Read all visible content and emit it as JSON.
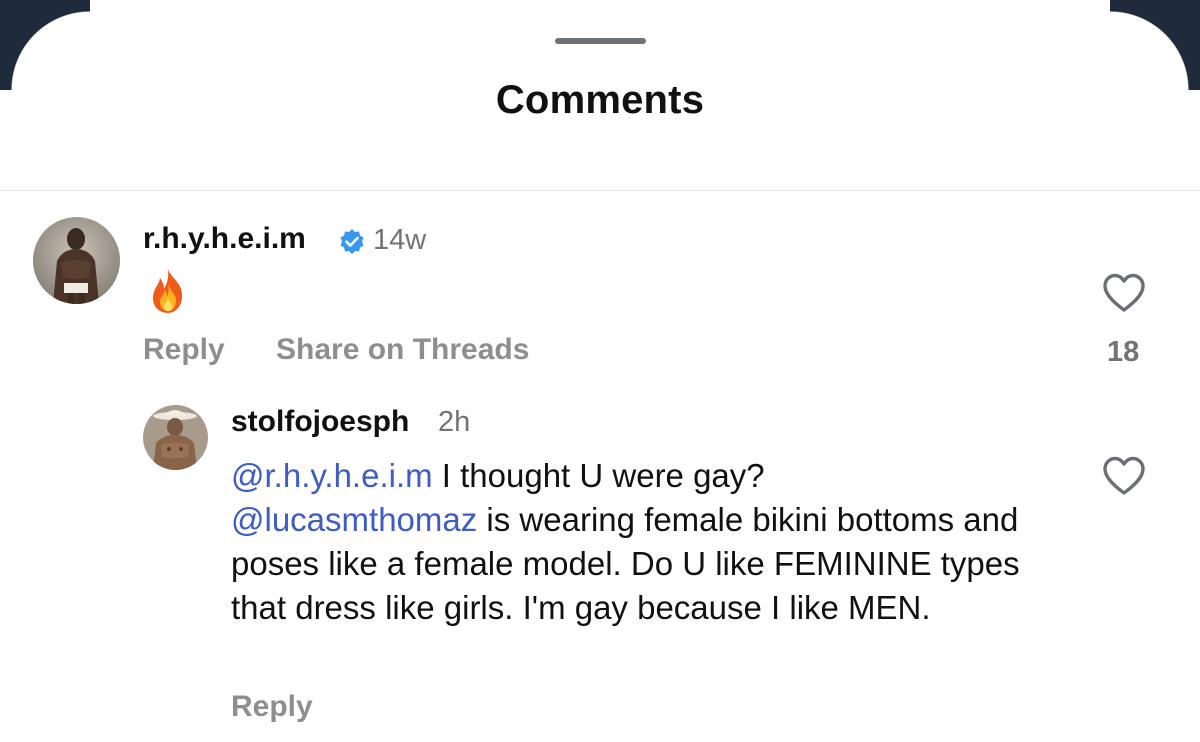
{
  "sheet": {
    "title": "Comments"
  },
  "comments": [
    {
      "username": "r.h.y.h.e.i.m",
      "verified": true,
      "time": "14w",
      "text": "🔥",
      "reply_label": "Reply",
      "share_label": "Share on Threads",
      "like_count": "18",
      "avatar_icon": "profile-photo",
      "like_icon": "heart-outline-icon"
    }
  ],
  "replies": [
    {
      "username": "stolfojoesph",
      "time": "2h",
      "mention_1": "@r.h.y.h.e.i.m",
      "text_1": " I thought U were gay?",
      "mention_2": "@lucasmthomaz",
      "text_2": " is wearing female bikini bottoms and poses like a female model. Do U like FEMININE types that dress like girls. I'm gay because I like MEN.",
      "reply_label": "Reply",
      "avatar_icon": "profile-photo",
      "like_icon": "heart-outline-icon"
    }
  ],
  "colors": {
    "mention": "#3d5cc4",
    "verified_badge": "#3897f0",
    "secondary_text": "#8e8e8e"
  }
}
